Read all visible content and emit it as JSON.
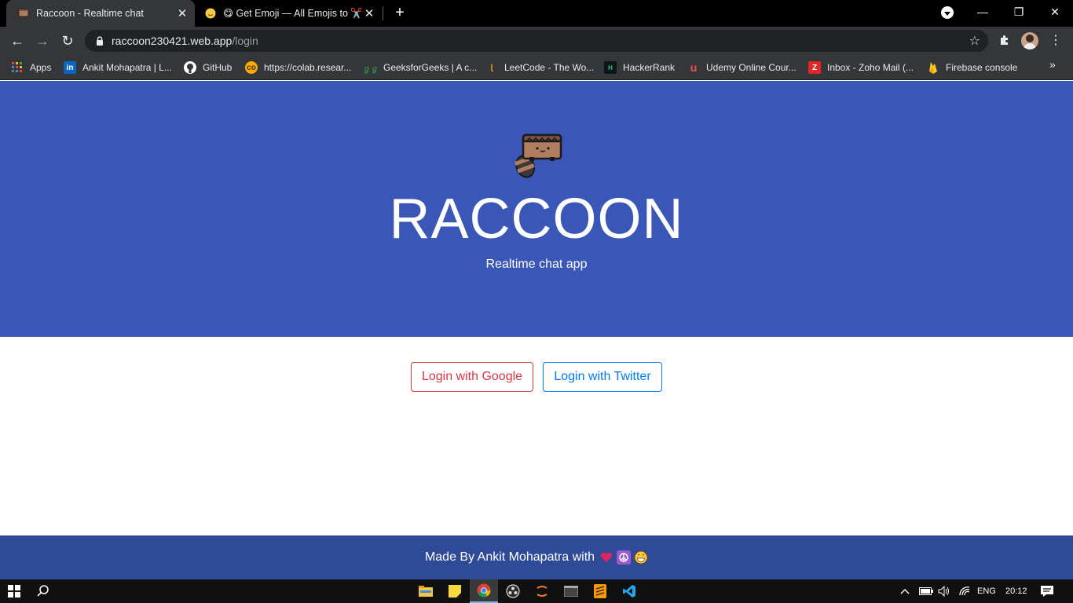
{
  "browser": {
    "tabs": [
      {
        "title": "Raccoon - Realtime chat",
        "active": true
      },
      {
        "title": "😋 Get Emoji — All Emojis to ✂️",
        "active": false
      }
    ],
    "url_host": "raccoon230421.web.app",
    "url_path": "/login",
    "bookmarks": [
      {
        "label": "Apps",
        "icon": "apps-grid-icon"
      },
      {
        "label": "Ankit Mohapatra | L...",
        "icon": "linkedin-icon"
      },
      {
        "label": "GitHub",
        "icon": "github-icon"
      },
      {
        "label": "https://colab.resear...",
        "icon": "colab-icon"
      },
      {
        "label": "GeeksforGeeks | A c...",
        "icon": "geeksforgeeks-icon"
      },
      {
        "label": "LeetCode - The Wo...",
        "icon": "leetcode-icon"
      },
      {
        "label": "HackerRank",
        "icon": "hackerrank-icon"
      },
      {
        "label": "Udemy Online Cour...",
        "icon": "udemy-icon"
      },
      {
        "label": "Inbox - Zoho Mail (...",
        "icon": "zoho-icon"
      },
      {
        "label": "Firebase console",
        "icon": "firebase-icon"
      }
    ]
  },
  "page": {
    "brand": "RACCOON",
    "tagline": "Realtime chat app",
    "login_google": "Login with Google",
    "login_twitter": "Login with Twitter",
    "footer_text": "Made By Ankit Mohapatra with",
    "colors": {
      "hero_bg": "#3a56b6",
      "footer_bg": "#2f4a96",
      "google": "#dc3545",
      "twitter": "#007bff"
    }
  },
  "taskbar": {
    "language": "ENG",
    "time": "20:12"
  }
}
